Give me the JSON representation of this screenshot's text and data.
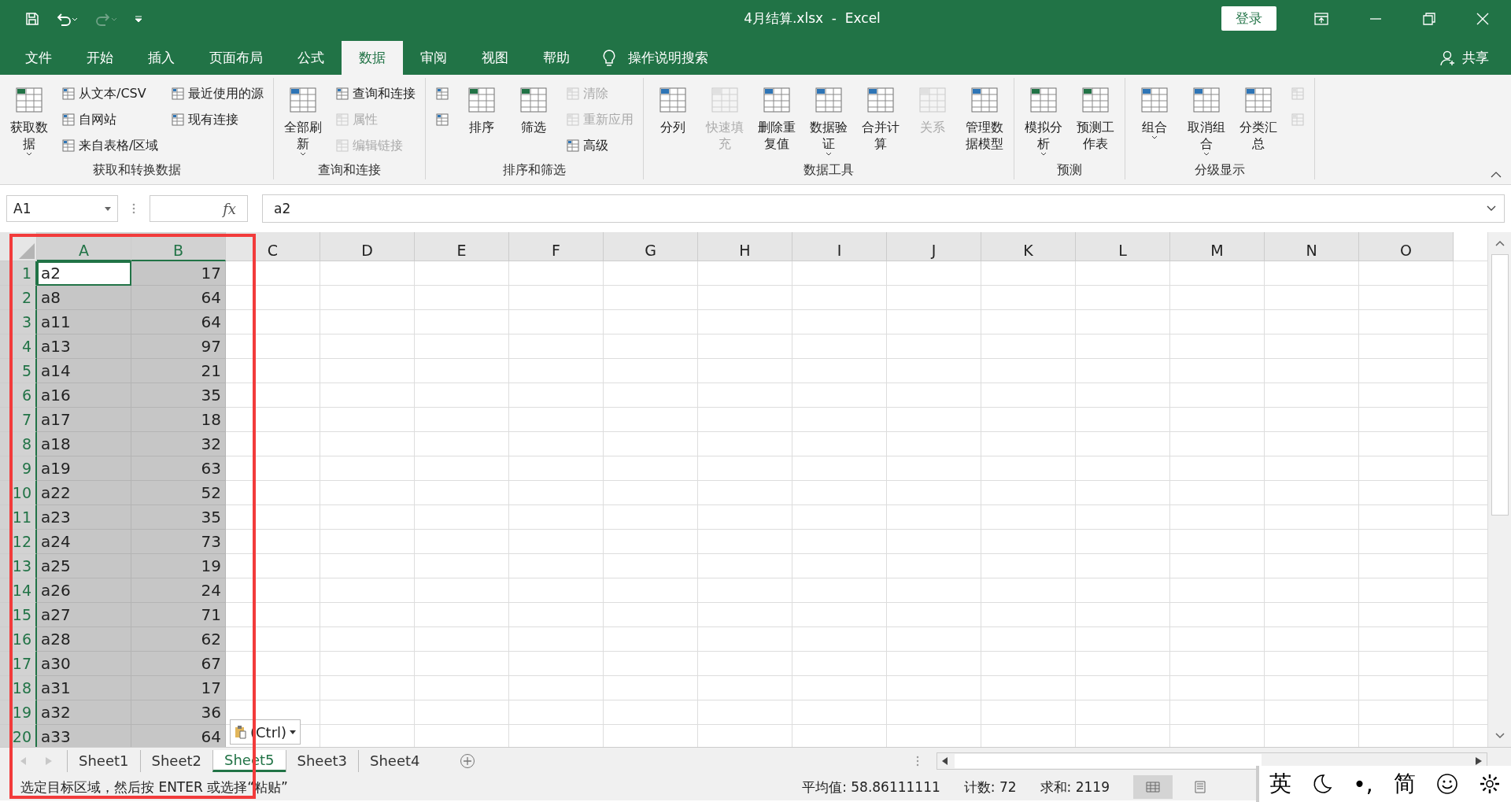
{
  "title_bar": {
    "title": "4月结算.xlsx  -  Excel",
    "login": "登录"
  },
  "menu_tabs": [
    {
      "label": "文件",
      "selected": false
    },
    {
      "label": "开始",
      "selected": false
    },
    {
      "label": "插入",
      "selected": false
    },
    {
      "label": "页面布局",
      "selected": false
    },
    {
      "label": "公式",
      "selected": false
    },
    {
      "label": "数据",
      "selected": true
    },
    {
      "label": "审阅",
      "selected": false
    },
    {
      "label": "视图",
      "selected": false
    },
    {
      "label": "帮助",
      "selected": false
    }
  ],
  "tell_me": "操作说明搜索",
  "share": "共享",
  "ribbon_groups": [
    {
      "label": "获取和转换数据",
      "columns": [
        {
          "kind": "large",
          "label": "获取数据",
          "disabled": false,
          "dropdown": true
        },
        {
          "kind": "stack",
          "items": [
            {
              "label": "从文本/CSV",
              "disabled": false
            },
            {
              "label": "自网站",
              "disabled": false
            },
            {
              "label": "来自表格/区域",
              "disabled": false
            }
          ]
        },
        {
          "kind": "stack",
          "items": [
            {
              "label": "最近使用的源",
              "disabled": false
            },
            {
              "label": "现有连接",
              "disabled": false
            }
          ]
        }
      ]
    },
    {
      "label": "查询和连接",
      "columns": [
        {
          "kind": "large",
          "label": "全部刷新",
          "disabled": false,
          "dropdown": true
        },
        {
          "kind": "stack",
          "items": [
            {
              "label": "查询和连接",
              "disabled": false
            },
            {
              "label": "属性",
              "disabled": true
            },
            {
              "label": "编辑链接",
              "disabled": true
            }
          ]
        }
      ]
    },
    {
      "label": "排序和筛选",
      "columns": [
        {
          "kind": "stack",
          "items": [
            {
              "disabled": false
            },
            {
              "disabled": false
            }
          ]
        },
        {
          "kind": "large",
          "label": "排序",
          "disabled": false,
          "dropdown": false
        },
        {
          "kind": "large",
          "label": "筛选",
          "disabled": false,
          "dropdown": false
        },
        {
          "kind": "stack",
          "items": [
            {
              "label": "清除",
              "disabled": true
            },
            {
              "label": "重新应用",
              "disabled": true
            },
            {
              "label": "高级",
              "disabled": false
            }
          ]
        }
      ]
    },
    {
      "label": "数据工具",
      "columns": [
        {
          "kind": "large",
          "label": "分列",
          "disabled": false,
          "dropdown": false
        },
        {
          "kind": "large",
          "label": "快速填充",
          "disabled": true,
          "dropdown": false
        },
        {
          "kind": "large",
          "label": "删除重复值",
          "disabled": false,
          "dropdown": false
        },
        {
          "kind": "large",
          "label": "数据验证",
          "disabled": false,
          "dropdown": true
        },
        {
          "kind": "large",
          "label": "合并计算",
          "disabled": false,
          "dropdown": false
        },
        {
          "kind": "large",
          "label": "关系",
          "disabled": true,
          "dropdown": false
        },
        {
          "kind": "large",
          "label": "管理数据模型",
          "disabled": false,
          "dropdown": false
        }
      ]
    },
    {
      "label": "预测",
      "columns": [
        {
          "kind": "large",
          "label": "模拟分析",
          "disabled": false,
          "dropdown": true
        },
        {
          "kind": "large",
          "label": "预测工作表",
          "disabled": false,
          "dropdown": false
        }
      ]
    },
    {
      "label": "分级显示",
      "columns": [
        {
          "kind": "large",
          "label": "组合",
          "disabled": false,
          "dropdown": true
        },
        {
          "kind": "large",
          "label": "取消组合",
          "disabled": false,
          "dropdown": true
        },
        {
          "kind": "large",
          "label": "分类汇总",
          "disabled": false,
          "dropdown": false
        },
        {
          "kind": "stack",
          "items": [
            {
              "disabled": true
            },
            {
              "disabled": true
            }
          ]
        }
      ]
    }
  ],
  "formula_bar": {
    "name_box": "A1",
    "fx": "fx",
    "formula": "a2"
  },
  "columns": [
    {
      "label": "A",
      "selected": true
    },
    {
      "label": "B",
      "selected": true
    },
    {
      "label": "C",
      "selected": false
    },
    {
      "label": "D",
      "selected": false
    },
    {
      "label": "E",
      "selected": false
    },
    {
      "label": "F",
      "selected": false
    },
    {
      "label": "G",
      "selected": false
    },
    {
      "label": "H",
      "selected": false
    },
    {
      "label": "I",
      "selected": false
    },
    {
      "label": "J",
      "selected": false
    },
    {
      "label": "K",
      "selected": false
    },
    {
      "label": "L",
      "selected": false
    },
    {
      "label": "M",
      "selected": false
    },
    {
      "label": "N",
      "selected": false
    },
    {
      "label": "O",
      "selected": false
    }
  ],
  "rows": [
    {
      "number": "1",
      "selected": true,
      "cells": [
        {
          "text": "a2",
          "active": true
        },
        {
          "text": "17",
          "active": false
        }
      ]
    },
    {
      "number": "2",
      "selected": true,
      "cells": [
        {
          "text": "a8",
          "active": false
        },
        {
          "text": "64",
          "active": false
        }
      ]
    },
    {
      "number": "3",
      "selected": true,
      "cells": [
        {
          "text": "a11",
          "active": false
        },
        {
          "text": "64",
          "active": false
        }
      ]
    },
    {
      "number": "4",
      "selected": true,
      "cells": [
        {
          "text": "a13",
          "active": false
        },
        {
          "text": "97",
          "active": false
        }
      ]
    },
    {
      "number": "5",
      "selected": true,
      "cells": [
        {
          "text": "a14",
          "active": false
        },
        {
          "text": "21",
          "active": false
        }
      ]
    },
    {
      "number": "6",
      "selected": true,
      "cells": [
        {
          "text": "a16",
          "active": false
        },
        {
          "text": "35",
          "active": false
        }
      ]
    },
    {
      "number": "7",
      "selected": true,
      "cells": [
        {
          "text": "a17",
          "active": false
        },
        {
          "text": "18",
          "active": false
        }
      ]
    },
    {
      "number": "8",
      "selected": true,
      "cells": [
        {
          "text": "a18",
          "active": false
        },
        {
          "text": "32",
          "active": false
        }
      ]
    },
    {
      "number": "9",
      "selected": true,
      "cells": [
        {
          "text": "a19",
          "active": false
        },
        {
          "text": "63",
          "active": false
        }
      ]
    },
    {
      "number": "10",
      "selected": true,
      "cells": [
        {
          "text": "a22",
          "active": false
        },
        {
          "text": "52",
          "active": false
        }
      ]
    },
    {
      "number": "11",
      "selected": true,
      "cells": [
        {
          "text": "a23",
          "active": false
        },
        {
          "text": "35",
          "active": false
        }
      ]
    },
    {
      "number": "12",
      "selected": true,
      "cells": [
        {
          "text": "a24",
          "active": false
        },
        {
          "text": "73",
          "active": false
        }
      ]
    },
    {
      "number": "13",
      "selected": true,
      "cells": [
        {
          "text": "a25",
          "active": false
        },
        {
          "text": "19",
          "active": false
        }
      ]
    },
    {
      "number": "14",
      "selected": true,
      "cells": [
        {
          "text": "a26",
          "active": false
        },
        {
          "text": "24",
          "active": false
        }
      ]
    },
    {
      "number": "15",
      "selected": true,
      "cells": [
        {
          "text": "a27",
          "active": false
        },
        {
          "text": "71",
          "active": false
        }
      ]
    },
    {
      "number": "16",
      "selected": true,
      "cells": [
        {
          "text": "a28",
          "active": false
        },
        {
          "text": "62",
          "active": false
        }
      ]
    },
    {
      "number": "17",
      "selected": true,
      "cells": [
        {
          "text": "a30",
          "active": false
        },
        {
          "text": "67",
          "active": false
        }
      ]
    },
    {
      "number": "18",
      "selected": true,
      "cells": [
        {
          "text": "a31",
          "active": false
        },
        {
          "text": "17",
          "active": false
        }
      ]
    },
    {
      "number": "19",
      "selected": true,
      "cells": [
        {
          "text": "a32",
          "active": false
        },
        {
          "text": "36",
          "active": false
        }
      ]
    },
    {
      "number": "20",
      "selected": true,
      "cells": [
        {
          "text": "a33",
          "active": false
        },
        {
          "text": "64",
          "active": false
        }
      ]
    }
  ],
  "paste_options": "(Ctrl)",
  "sheet_tabs": [
    {
      "label": "Sheet1",
      "selected": false
    },
    {
      "label": "Sheet2",
      "selected": false
    },
    {
      "label": "Sheet5",
      "selected": true
    },
    {
      "label": "Sheet3",
      "selected": false
    },
    {
      "label": "Sheet4",
      "selected": false
    }
  ],
  "status_bar": {
    "message": "选定目标区域，然后按 ENTER 或选择“粘贴”",
    "average": "平均值: 58.86111111",
    "count": "计数: 72",
    "sum": "求和: 2119"
  },
  "ime_bar": [
    {
      "kind": "text",
      "label": "英"
    },
    {
      "kind": "moon"
    },
    {
      "kind": "text",
      "label": "•,"
    },
    {
      "kind": "text",
      "label": "简"
    },
    {
      "kind": "smiley"
    },
    {
      "kind": "gear"
    }
  ]
}
